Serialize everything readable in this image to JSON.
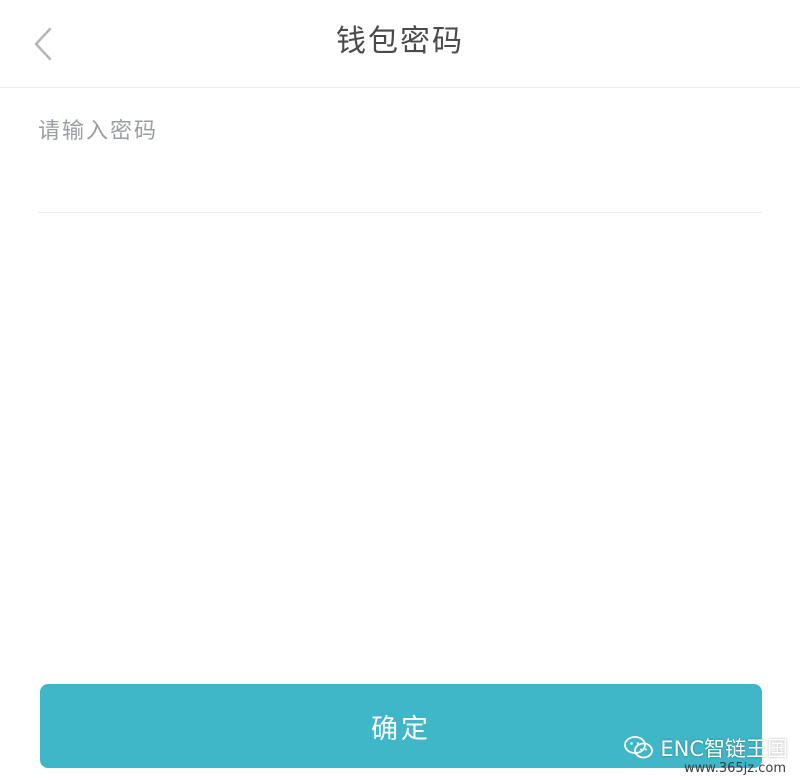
{
  "header": {
    "title": "钱包密码",
    "back_icon": "chevron-left-icon"
  },
  "form": {
    "password": {
      "placeholder": "请输入密码",
      "value": ""
    }
  },
  "actions": {
    "confirm_label": "确定"
  },
  "watermark": {
    "brand": "ENC智链王国",
    "url": "www.365jz.com",
    "icon": "wechat-icon"
  },
  "colors": {
    "accent": "#3fb7c9",
    "title_text": "#4a4a4a",
    "placeholder_text": "#9a9ea3",
    "divider": "#ececec"
  }
}
